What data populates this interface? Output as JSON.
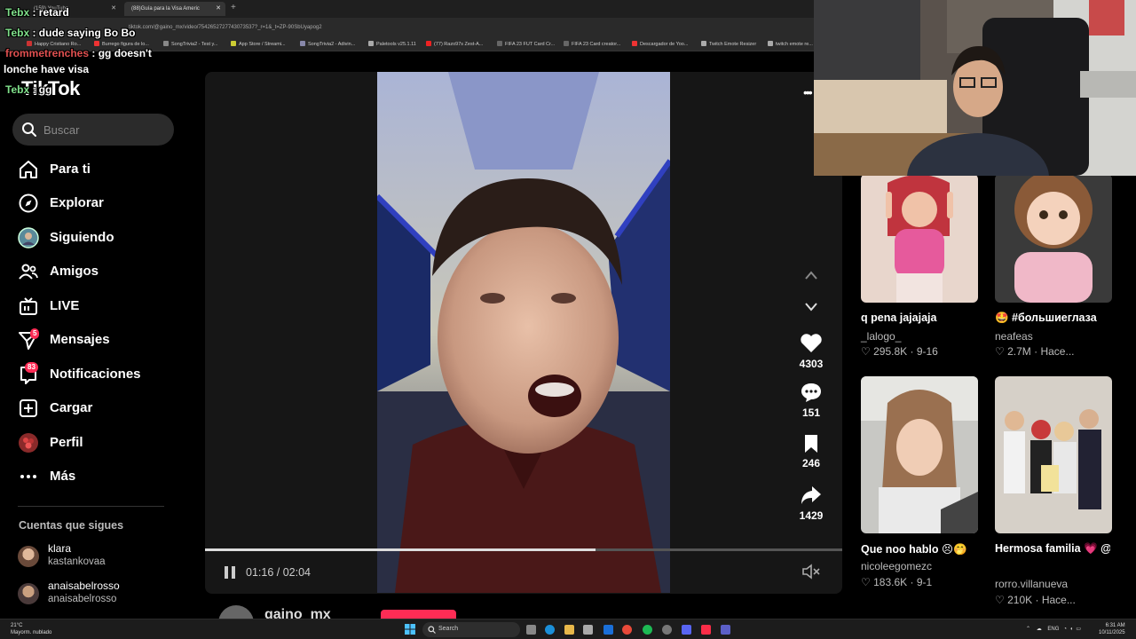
{
  "browser": {
    "tabs": [
      {
        "label": "(159) YouTube",
        "active": false
      },
      {
        "label": "(88)Guía para la Visa Americ",
        "active": true
      }
    ],
    "url": "tiktok.com/@gaino_mx/video/7542652727743073537?_r=1&_t=ZP-90SbUyapog2",
    "bookmarks": [
      "Happy Cristiano Ro...",
      "Burrego figura de lo...",
      "SongTrivia2 - Test y...",
      "App Store / Streami...",
      "SongTrivia2 - Adivin...",
      "Paletools v25.1.11",
      "(77) Razo97s Zest-A...",
      "FIFA 23 FUT Card Cr...",
      "FIFA 23 Card creator...",
      "Descargador de Yoo...",
      "Twitch Emote Resizer",
      "twitch emote re..."
    ]
  },
  "chat": [
    {
      "user": "Tebx",
      "text": " : retard"
    },
    {
      "user": "Tebx",
      "text": " : dude saying Bo Bo"
    },
    {
      "user": "frommetrenches",
      "text": " : gg doesn't"
    },
    {
      "user": "",
      "text": "lonche have visa"
    },
    {
      "user": "Tebx",
      "text": " : gg"
    }
  ],
  "sidebar": {
    "logo": "TikTok",
    "search_placeholder": "Buscar",
    "nav": [
      {
        "label": "Para ti",
        "icon": "home-icon",
        "badge": ""
      },
      {
        "label": "Explorar",
        "icon": "compass-icon",
        "badge": ""
      },
      {
        "label": "Siguiendo",
        "icon": "following-avatar-icon",
        "badge": ""
      },
      {
        "label": "Amigos",
        "icon": "friends-icon",
        "badge": ""
      },
      {
        "label": "LIVE",
        "icon": "live-tv-icon",
        "badge": ""
      },
      {
        "label": "Mensajes",
        "icon": "send-icon",
        "badge": "5"
      },
      {
        "label": "Notificaciones",
        "icon": "inbox-icon",
        "badge": "83"
      },
      {
        "label": "Cargar",
        "icon": "upload-icon",
        "badge": ""
      },
      {
        "label": "Perfil",
        "icon": "profile-avatar-icon",
        "badge": ""
      },
      {
        "label": "Más",
        "icon": "more-dots-icon",
        "badge": ""
      }
    ],
    "following_title": "Cuentas que sigues",
    "accounts": [
      {
        "name": "klara",
        "handle": "kastankovaa"
      },
      {
        "name": "anaisabelrosso",
        "handle": "anaisabelrosso"
      }
    ]
  },
  "video": {
    "current_time": "01:16",
    "duration": "02:04",
    "progress": 0.613,
    "author": "gaino_mx",
    "likes": "4303",
    "comments": "151",
    "saves": "246",
    "shares": "1429"
  },
  "recommended": [
    {
      "title": "q pena jajajaja",
      "author": "_lalogo_",
      "likes": "295.8K",
      "date": "9-16"
    },
    {
      "title": "🤩 #большиеглаза",
      "author": "neafeas",
      "likes": "2.7M",
      "date": "Hace..."
    },
    {
      "title": "Que noo hablo 😣🤭",
      "author": "nicoleegomezc",
      "likes": "183.6K",
      "date": "9-1"
    },
    {
      "title": "Hermosa familia 💗 @Nicolle Figueroa...",
      "author": "rorro.villanueva",
      "likes": "210K",
      "date": "Hace..."
    }
  ],
  "taskbar": {
    "temp": "21°C",
    "weather": "Mayorm. nublado",
    "search": "Search",
    "lang": "ENG",
    "time": "6:31 AM",
    "date": "10/11/2025"
  },
  "colors": {
    "accent": "#fe2c55",
    "background": "#000000",
    "panel": "#161616",
    "chat_user": "#7fe08a"
  }
}
